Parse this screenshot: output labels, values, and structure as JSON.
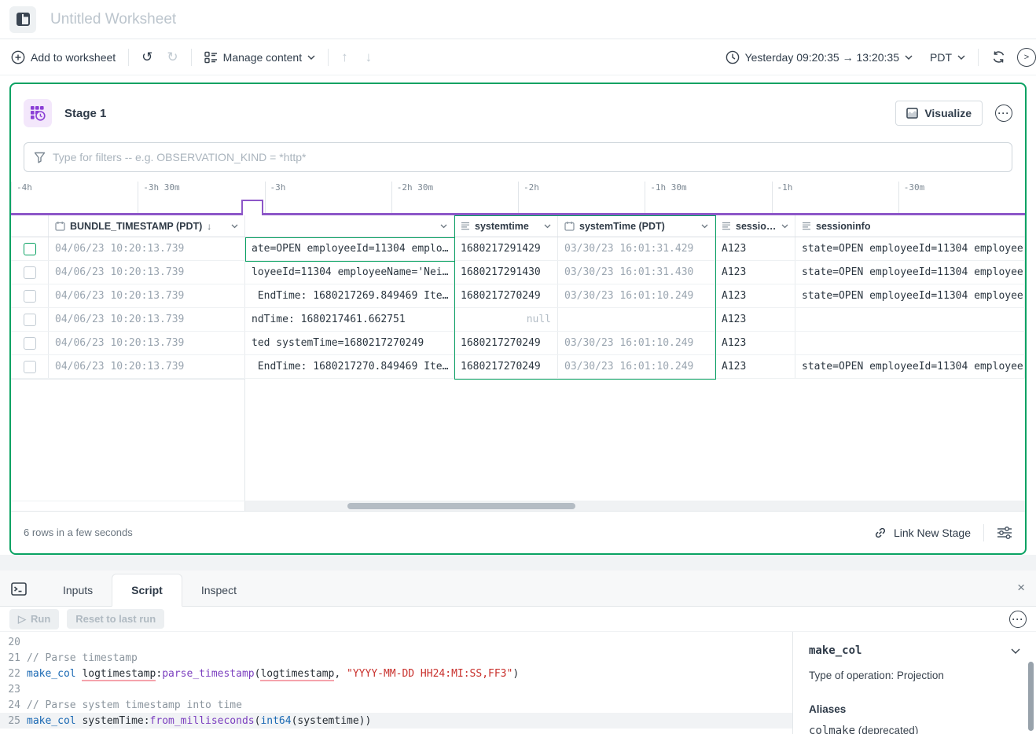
{
  "colors": {
    "accent_green": "#0aa263",
    "accent_purple": "#8d57c8",
    "stage_icon_purple": "#8b3fd6"
  },
  "header": {
    "title_placeholder": "Untitled Worksheet"
  },
  "toolbar": {
    "add_to_worksheet": "Add to worksheet",
    "manage_content": "Manage content",
    "time_range": "Yesterday 09:20:35 → 13:20:35",
    "timezone": "PDT"
  },
  "stage": {
    "title": "Stage 1",
    "visualize_label": "Visualize",
    "filter_placeholder": "Type for filters -- e.g. OBSERVATION_KIND = *http*",
    "timeline_ticks": [
      "-4h",
      "-3h 30m",
      "-3h",
      "-2h 30m",
      "-2h",
      "-1h 30m",
      "-1h",
      "-30m"
    ],
    "table": {
      "columns": [
        {
          "name": "BUNDLE_TIMESTAMP (PDT)",
          "icon": "calendar",
          "sorted": "desc"
        },
        {
          "name": "",
          "icon": "none"
        },
        {
          "name": "systemtime",
          "icon": "text"
        },
        {
          "name": "systemTime (PDT)",
          "icon": "calendar"
        },
        {
          "name": "sessionid",
          "icon": "text"
        },
        {
          "name": "sessioninfo",
          "icon": "text"
        }
      ],
      "rows": [
        {
          "bundle_timestamp": "04/06/23 10:20:13.739",
          "log": "ate=OPEN employeeId=11304 emplo…",
          "systemtime": "1680217291429",
          "system_time_pdt": "03/30/23 16:01:31.429",
          "sessionid": "A123",
          "sessioninfo": "state=OPEN employeeId=11304 employee"
        },
        {
          "bundle_timestamp": "04/06/23 10:20:13.739",
          "log": "loyeeId=11304 employeeName='Nei…",
          "systemtime": "1680217291430",
          "system_time_pdt": "03/30/23 16:01:31.430",
          "sessionid": "A123",
          "sessioninfo": "state=OPEN employeeId=11304 employee"
        },
        {
          "bundle_timestamp": "04/06/23 10:20:13.739",
          "log": " EndTime: 1680217269.849469 Ite…",
          "systemtime": "1680217270249",
          "system_time_pdt": "03/30/23 16:01:10.249",
          "sessionid": "A123",
          "sessioninfo": "state=OPEN employeeId=11304 employee"
        },
        {
          "bundle_timestamp": "04/06/23 10:20:13.739",
          "log": "ndTime: 1680217461.662751",
          "systemtime": "null",
          "system_time_pdt": "",
          "sessionid": "A123",
          "sessioninfo": ""
        },
        {
          "bundle_timestamp": "04/06/23 10:20:13.739",
          "log": "ted systemTime=1680217270249",
          "systemtime": "1680217270249",
          "system_time_pdt": "03/30/23 16:01:10.249",
          "sessionid": "A123",
          "sessioninfo": ""
        },
        {
          "bundle_timestamp": "04/06/23 10:20:13.739",
          "log": " EndTime: 1680217270.849469 Ite…",
          "systemtime": "1680217270249",
          "system_time_pdt": "03/30/23 16:01:10.249",
          "sessionid": "A123",
          "sessioninfo": "state=OPEN employeeId=11304 employee"
        }
      ]
    },
    "status": "6 rows in a few seconds",
    "link_new_stage": "Link New Stage"
  },
  "bottom_panel": {
    "tabs": [
      "Inputs",
      "Script",
      "Inspect"
    ],
    "active_tab": "Script",
    "run_label": "Run",
    "reset_label": "Reset to last run",
    "editor": {
      "lines": [
        {
          "n": 20,
          "tokens": []
        },
        {
          "n": 21,
          "tokens": [
            {
              "t": "// Parse timestamp",
              "c": "cmt"
            }
          ]
        },
        {
          "n": 22,
          "tokens": [
            {
              "t": "make_col",
              "c": "kw"
            },
            {
              "t": " ",
              "c": "pln"
            },
            {
              "t": "logtimestamp",
              "c": "pln u"
            },
            {
              "t": ":",
              "c": "pln"
            },
            {
              "t": "parse_timestamp",
              "c": "fn"
            },
            {
              "t": "(",
              "c": "pln"
            },
            {
              "t": "logtimestamp",
              "c": "pln u"
            },
            {
              "t": ", ",
              "c": "pln"
            },
            {
              "t": "\"YYYY-MM-DD HH24:MI:SS,FF3\"",
              "c": "str"
            },
            {
              "t": ")",
              "c": "pln"
            }
          ]
        },
        {
          "n": 23,
          "tokens": []
        },
        {
          "n": 24,
          "tokens": [
            {
              "t": "// Parse system timestamp into time",
              "c": "cmt"
            }
          ]
        },
        {
          "n": 25,
          "highlight": true,
          "tokens": [
            {
              "t": "make_col",
              "c": "kw"
            },
            {
              "t": " ",
              "c": "pln"
            },
            {
              "t": "systemTime:",
              "c": "pln"
            },
            {
              "t": "from_milliseconds",
              "c": "fn"
            },
            {
              "t": "(",
              "c": "pln"
            },
            {
              "t": "int64",
              "c": "kw"
            },
            {
              "t": "(systemtime))",
              "c": "pln"
            }
          ]
        }
      ]
    },
    "docs": {
      "function_name": "make_col",
      "type_line": "Type of operation: Projection",
      "aliases_heading": "Aliases",
      "alias": "colmake",
      "alias_suffix": " (deprecated)"
    }
  }
}
